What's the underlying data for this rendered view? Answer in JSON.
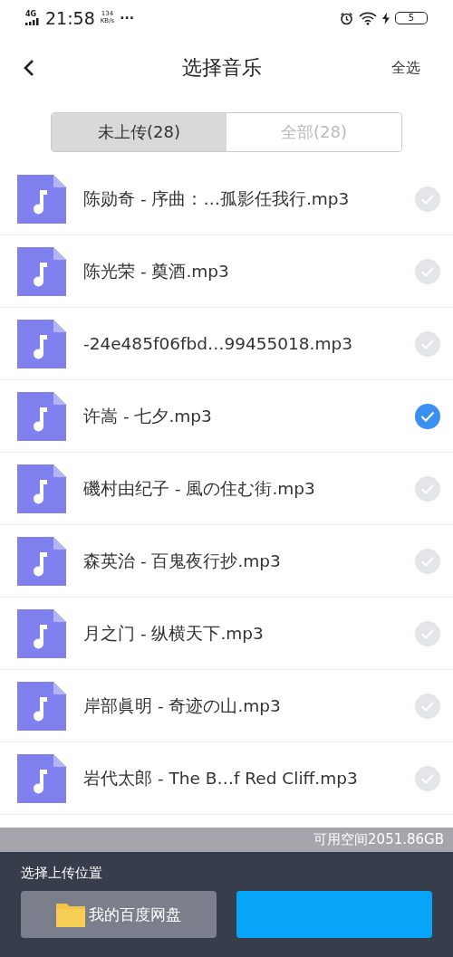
{
  "status_bar": {
    "network": "4G",
    "time": "21:58",
    "speed": "134",
    "speed_unit": "KB/s",
    "more": "···",
    "battery": "5"
  },
  "header": {
    "title": "选择音乐",
    "action": "全选"
  },
  "tabs": [
    {
      "label": "未上传(28)",
      "selected": true
    },
    {
      "label": "全部(28)",
      "selected": false
    }
  ],
  "files": [
    {
      "name": "陈勋奇 - 序曲：…孤影任我行.mp3",
      "checked": false
    },
    {
      "name": "陈光荣 - 奠酒.mp3",
      "checked": false
    },
    {
      "name": "-24e485f06fbd…99455018.mp3",
      "checked": false
    },
    {
      "name": "许嵩 - 七夕.mp3",
      "checked": true
    },
    {
      "name": "磯村由纪子 - 風の住む街.mp3",
      "checked": false
    },
    {
      "name": "森英治 - 百鬼夜行抄.mp3",
      "checked": false
    },
    {
      "name": "月之门 - 纵横天下.mp3",
      "checked": false
    },
    {
      "name": "岸部眞明 - 奇迹の山.mp3",
      "checked": false
    },
    {
      "name": "岩代太郎 - The B…f Red Cliff.mp3",
      "checked": false
    }
  ],
  "storage": "可用空间2051.86GB",
  "upload_panel": {
    "label": "选择上传位置",
    "location": "我的百度网盘"
  }
}
